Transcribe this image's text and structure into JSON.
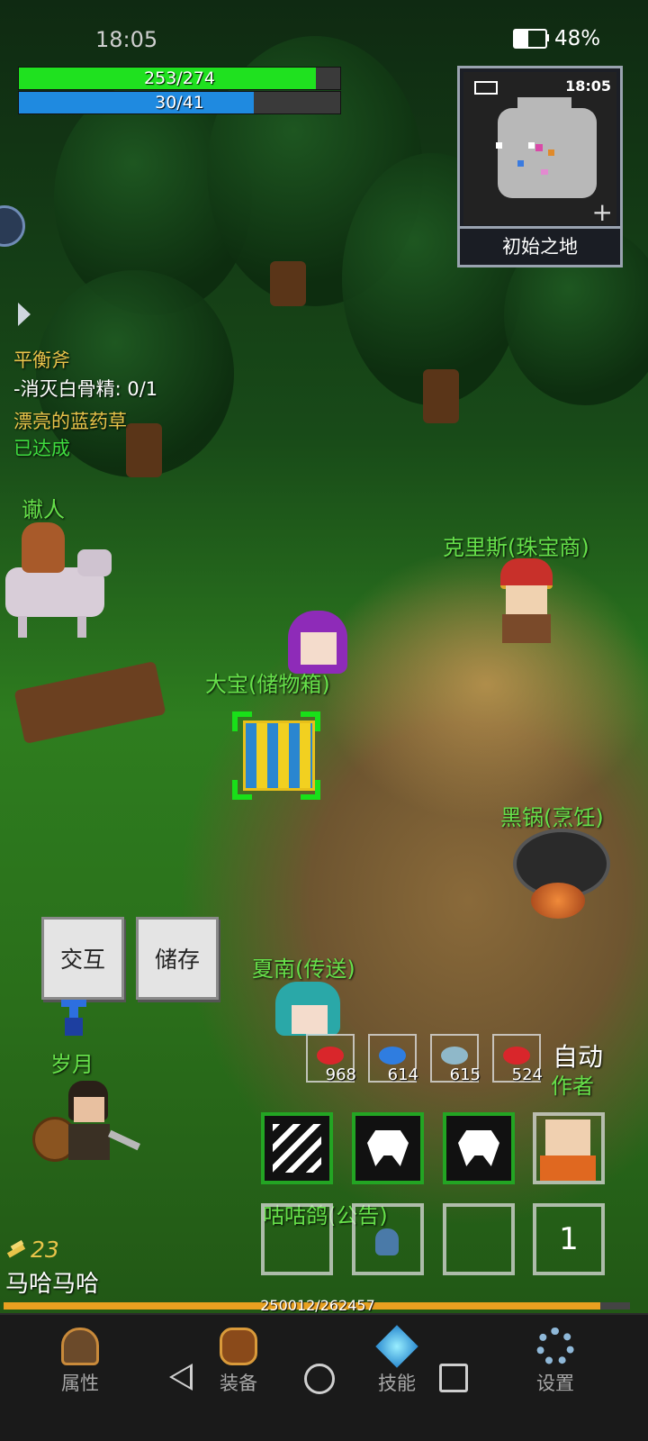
{
  "status_bar": {
    "time": "18:05",
    "battery": "48%"
  },
  "hp": {
    "text": "253/274",
    "fraction": 0.923,
    "color": "#1fe11f"
  },
  "mp": {
    "text": "30/41",
    "fraction": 0.732,
    "color": "#1f8ae0"
  },
  "minimap": {
    "time": "18:05",
    "location": "初始之地",
    "plus": "+"
  },
  "quests": [
    {
      "text": "平衡斧",
      "color": "#e8c34a"
    },
    {
      "text": "-消灭白骨精: 0/1",
      "color": "#ffffff"
    },
    {
      "text": "漂亮的蓝药草",
      "color": "#e8c34a"
    },
    {
      "text": "已达成",
      "color": "#3fdc3f"
    }
  ],
  "npcs": {
    "xie": "谳人",
    "chris": "克里斯(珠宝商)",
    "dabao": "大宝(储物箱)",
    "heiguo": "黑锅(烹饪)",
    "xianan": "夏南(传送)",
    "suiyue": "岁月",
    "author": "作者",
    "gugu": "咕咕鸽(公告)"
  },
  "actions": {
    "interact": "交互",
    "store": "储存",
    "auto": "自动"
  },
  "consumables": [
    {
      "icon": "red-meat-icon",
      "count": "968",
      "color": "#d9262b"
    },
    {
      "icon": "blue-fish-icon",
      "count": "614",
      "color": "#2f7de0"
    },
    {
      "icon": "grey-fish-icon",
      "count": "615",
      "color": "#8fb8c9"
    },
    {
      "icon": "red-meat-icon",
      "count": "524",
      "color": "#d9262b"
    }
  ],
  "skills": [
    {
      "icon": "slash-skill-icon"
    },
    {
      "icon": "bug-skill-icon"
    },
    {
      "icon": "bug-skill-icon"
    }
  ],
  "slot_number": "1",
  "player": {
    "level": "23",
    "name": "马哈马哈",
    "exp": "250012/262457",
    "exp_fraction": 0.953
  },
  "nav": {
    "attributes": "属性",
    "equipment": "装备",
    "skills": "技能",
    "settings": "设置"
  },
  "colors": {
    "npc_name": "#66e04a",
    "skill_border": "#23a523",
    "exp_bar": "#e8a020"
  }
}
